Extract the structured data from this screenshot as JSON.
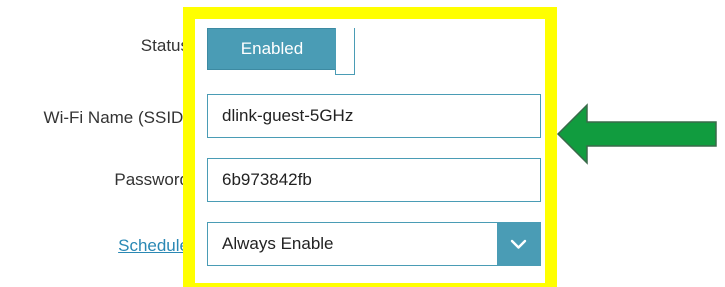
{
  "form": {
    "status_label": "Status",
    "ssid_label": "Wi-Fi Name (SSID)",
    "password_label": "Password",
    "schedule_label": "Schedule"
  },
  "status": {
    "toggle_label": "Enabled",
    "state": "on"
  },
  "ssid": {
    "value": "dlink-guest-5GHz"
  },
  "password": {
    "value": "6b973842fb"
  },
  "schedule": {
    "selected": "Always Enable"
  },
  "colors": {
    "accent": "#4a9cb5",
    "highlight": "#ffff00",
    "arrow": "#119c3f",
    "link": "#2a88b4"
  },
  "icons": {
    "dropdown": "chevron-down-icon",
    "pointer": "green-arrow-icon"
  }
}
